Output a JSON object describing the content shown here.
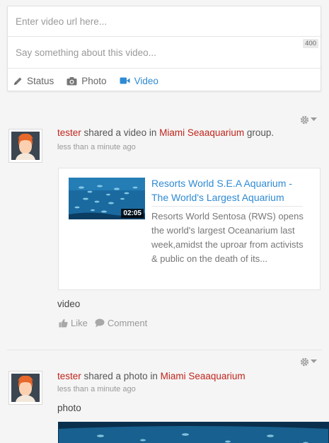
{
  "composer": {
    "url_placeholder": "Enter video url here...",
    "message_placeholder": "Say something about this video...",
    "char_limit": "400",
    "tabs": [
      {
        "label": "Status",
        "icon": "pencil-icon",
        "active": false
      },
      {
        "label": "Photo",
        "icon": "camera-icon",
        "active": false
      },
      {
        "label": "Video",
        "icon": "video-camera-icon",
        "active": true
      }
    ]
  },
  "feed": [
    {
      "user": "tester",
      "action_text": " shared a video in ",
      "group": "Miami Seaaquarium",
      "suffix": " group.",
      "time": "less than a minute ago",
      "video": {
        "title": "Resorts World S.E.A Aquarium - The World's Largest Aquarium",
        "duration": "02:05",
        "description": "Resorts World Sentosa (RWS) opens the world's largest Oceanarium last week,amidst the uproar from activists & public on the death of its..."
      },
      "message": "video",
      "actions": {
        "like": "Like",
        "comment": "Comment"
      }
    },
    {
      "user": "tester",
      "action_text": " shared a photo in ",
      "group": "Miami Seaaquarium",
      "suffix": "",
      "time": "less than a minute ago",
      "message": "photo"
    }
  ],
  "colors": {
    "link_blue": "#2f8ad3",
    "user_red": "#c0241c",
    "muted": "#999999"
  }
}
